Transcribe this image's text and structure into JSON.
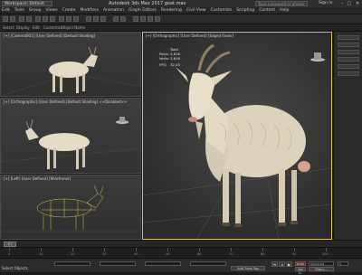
{
  "titlebar": {
    "workspace": "Workspace: Default",
    "app_title": "Autodesk 3ds Max 2017     goat.max",
    "search_placeholder": "Type a keyword or phrase",
    "signin": "Sign In",
    "min": "–",
    "max": "□",
    "close": "✕"
  },
  "menu": [
    "Edit",
    "Tools",
    "Group",
    "Views",
    "Create",
    "Modifiers",
    "Animation",
    "Graph Editors",
    "Rendering",
    "Civil View",
    "Customize",
    "Scripting",
    "Content",
    "Help"
  ],
  "menu_workspace_dropdown": "Workspaces: Default",
  "subbar": {
    "select": "Select",
    "display": "Display",
    "edit": "Edit",
    "customize": "Customize",
    "object_name": "Object Name"
  },
  "viewports": {
    "top_left": "[+] [Camera001] [User Defined] [Default Shading]",
    "mid_left": "[+] [Orthographic] [User Defined] [Default Shading] <<Disabled>>",
    "bottom_left": "[+] [Left] [User Defined] [Wireframe]",
    "main": "[+] [Orthographic] [User Defined] [Edged Faces]"
  },
  "stats": {
    "header": "Total",
    "polys_label": "Polys:",
    "polys": "3,618",
    "verts_label": "Verts:",
    "verts": "3,616",
    "fps_label": "FPS:",
    "fps": "32.03"
  },
  "timeline": {
    "slider": "0 / 100",
    "ticks": [
      "0",
      "10",
      "20",
      "30",
      "40",
      "50",
      "60",
      "70",
      "80",
      "90",
      "100"
    ]
  },
  "statusbar": {
    "message": "Select Objects",
    "add_time_tag": "Add Time Tag",
    "auto": "Auto",
    "set_k": "Set K.",
    "selected": "Selected",
    "filters": "Filters...",
    "frame": "0"
  },
  "colors": {
    "active_viewport_border": "#d9c25a",
    "goat_body": "#e6dcc6",
    "wireframe": "#d8cc3a"
  }
}
